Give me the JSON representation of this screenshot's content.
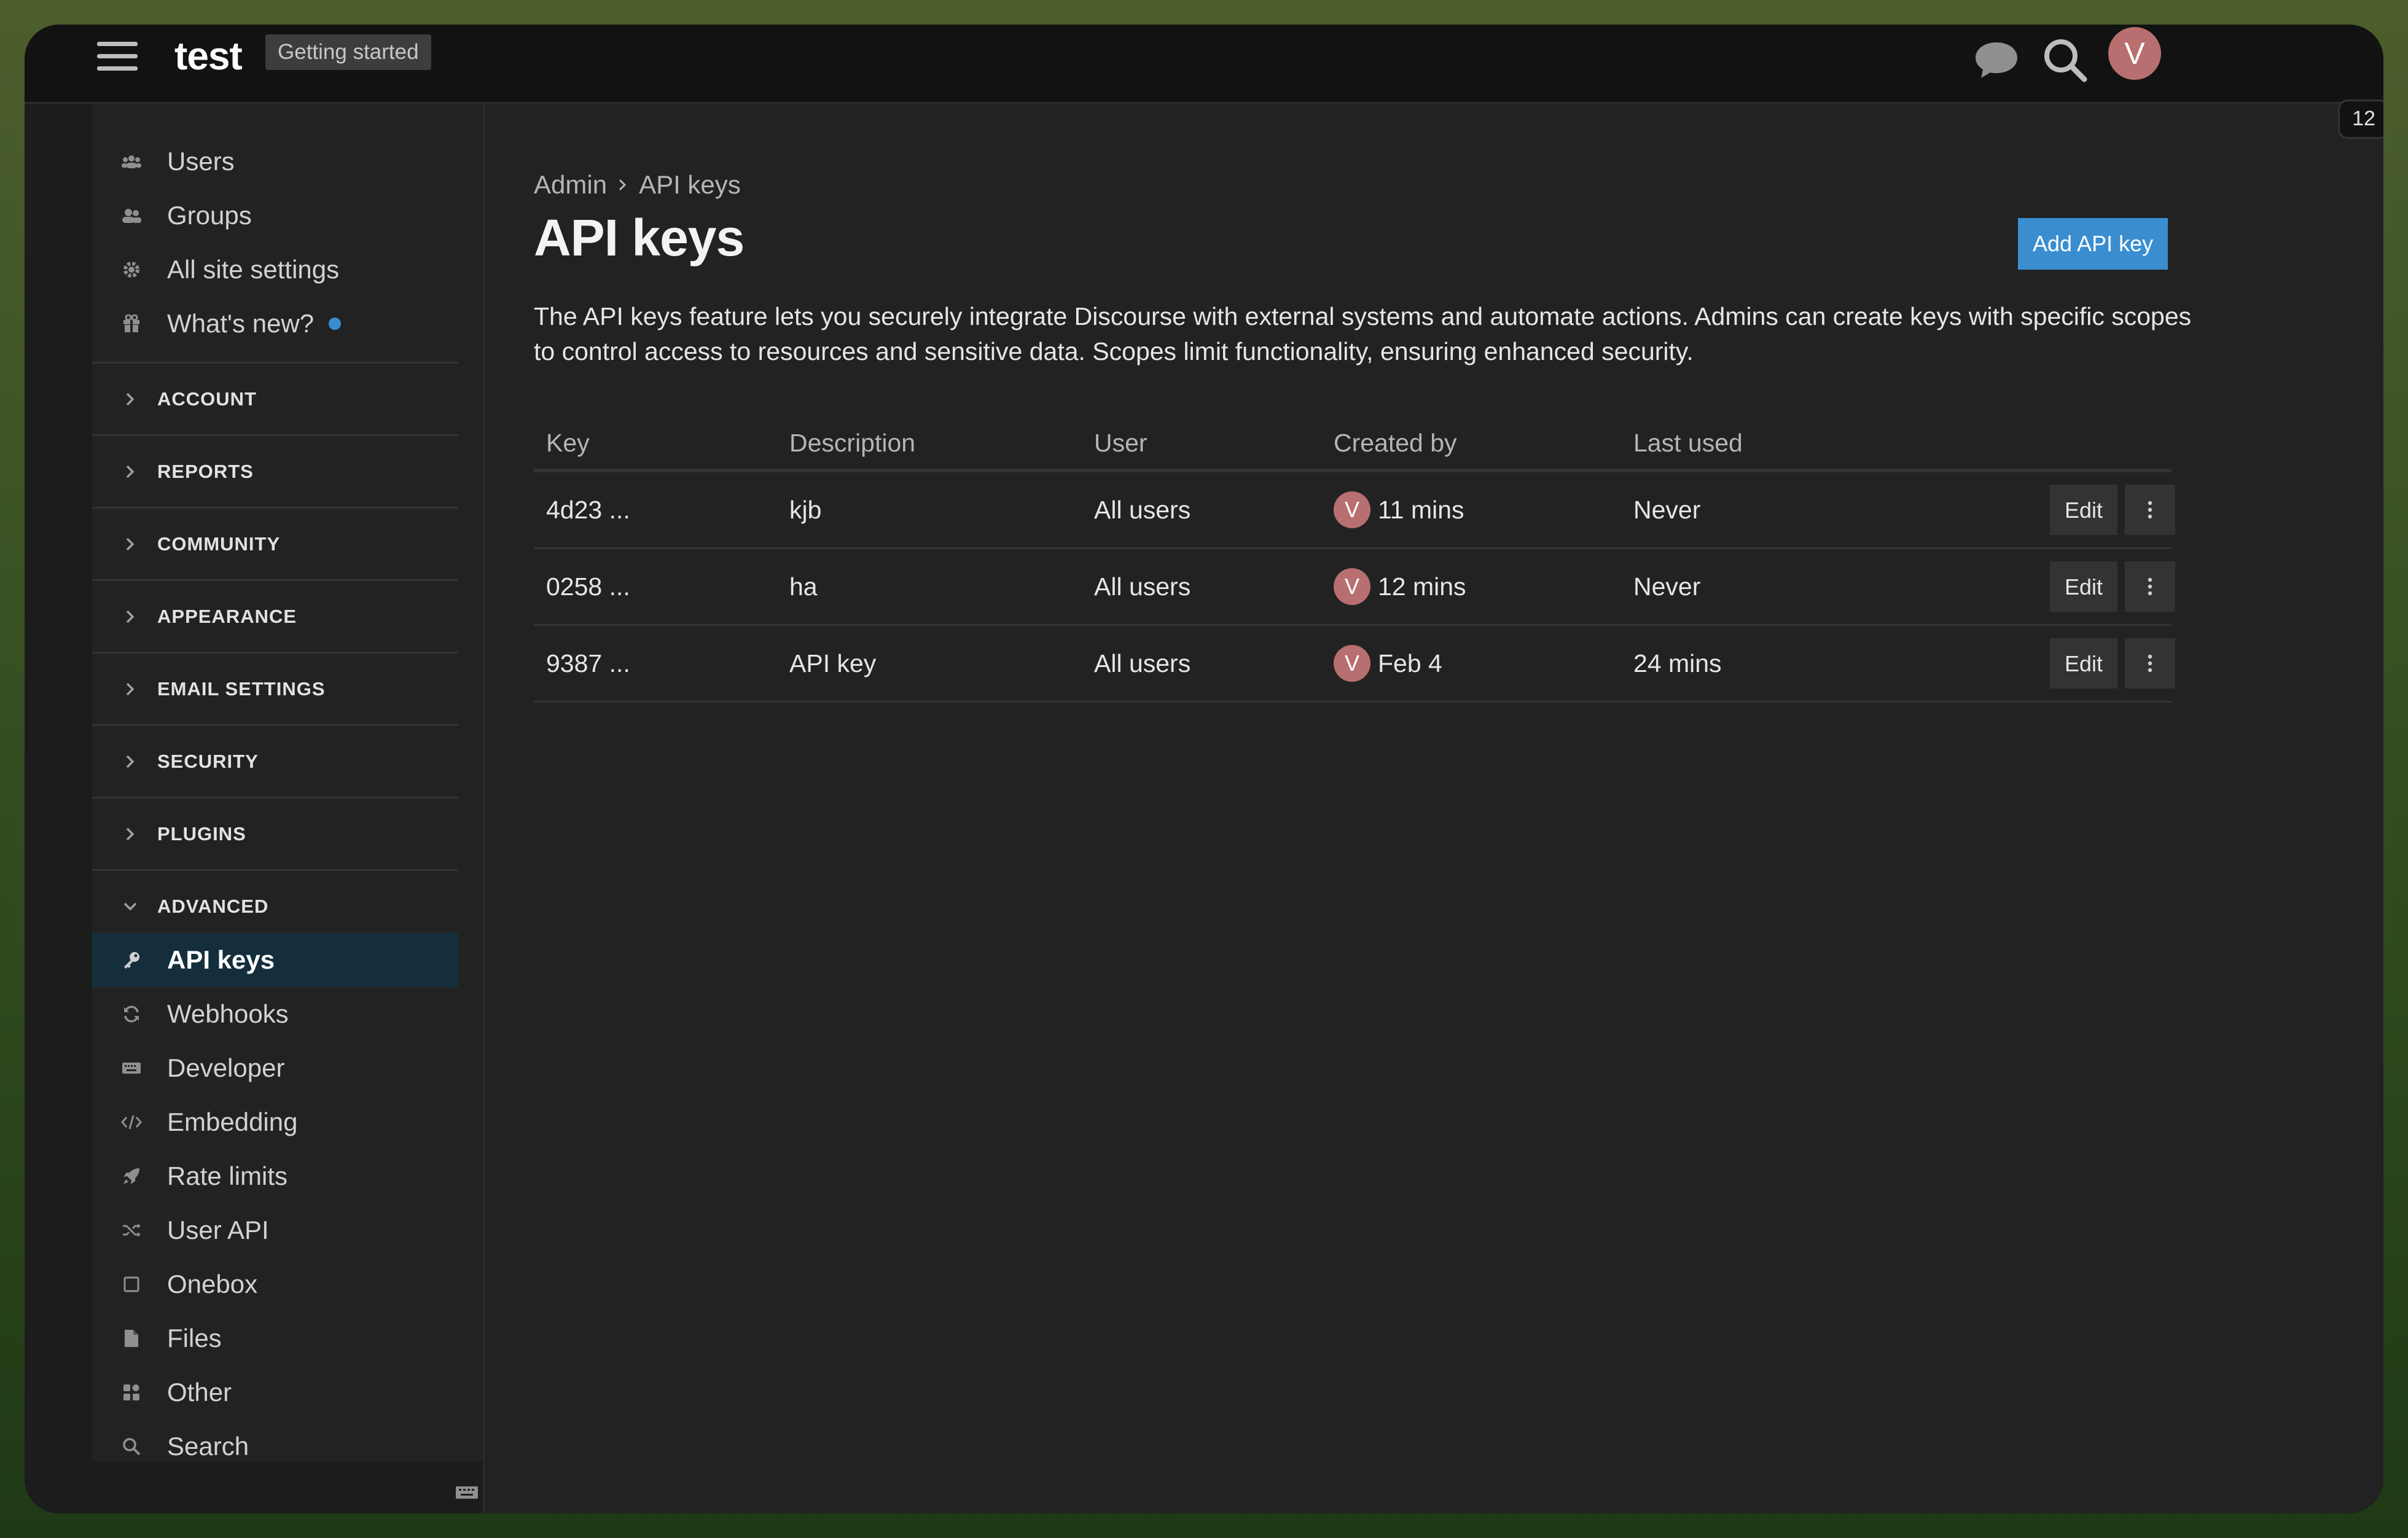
{
  "header": {
    "site_title": "test",
    "getting_started": "Getting started",
    "avatar_letter": "V",
    "notification_count": "12"
  },
  "sidebar": {
    "items_top": [
      {
        "label": "Users",
        "icon": "users-icon"
      },
      {
        "label": "Groups",
        "icon": "groups-icon"
      },
      {
        "label": "All site settings",
        "icon": "gear-icon"
      },
      {
        "label": "What's new?",
        "icon": "gift-icon"
      }
    ],
    "sections": [
      {
        "label": "ACCOUNT"
      },
      {
        "label": "REPORTS"
      },
      {
        "label": "COMMUNITY"
      },
      {
        "label": "APPEARANCE"
      },
      {
        "label": "EMAIL SETTINGS"
      },
      {
        "label": "SECURITY"
      },
      {
        "label": "PLUGINS"
      },
      {
        "label": "ADVANCED"
      }
    ],
    "advanced_items": [
      {
        "label": "API keys",
        "icon": "key-icon",
        "active": true
      },
      {
        "label": "Webhooks",
        "icon": "refresh-icon"
      },
      {
        "label": "Developer",
        "icon": "keyboard-icon"
      },
      {
        "label": "Embedding",
        "icon": "code-icon"
      },
      {
        "label": "Rate limits",
        "icon": "rocket-icon"
      },
      {
        "label": "User API",
        "icon": "shuffle-icon"
      },
      {
        "label": "Onebox",
        "icon": "square-icon"
      },
      {
        "label": "Files",
        "icon": "file-icon"
      },
      {
        "label": "Other",
        "icon": "grid-icon"
      },
      {
        "label": "Search",
        "icon": "search-icon"
      }
    ]
  },
  "main": {
    "breadcrumb": [
      "Admin",
      "API keys"
    ],
    "title": "API keys",
    "add_button": "Add API key",
    "description": "The API keys feature lets you securely integrate Discourse with external systems and automate actions. Admins can create keys with specific scopes to control access to resources and sensitive data. Scopes limit functionality, ensuring enhanced security.",
    "columns": [
      "Key",
      "Description",
      "User",
      "Created by",
      "Last used"
    ],
    "rows": [
      {
        "key": "4d23 ...",
        "description": "kjb",
        "user": "All users",
        "created_avatar": "V",
        "created": "11 mins",
        "last_used": "Never"
      },
      {
        "key": "0258 ...",
        "description": "ha",
        "user": "All users",
        "created_avatar": "V",
        "created": "12 mins",
        "last_used": "Never"
      },
      {
        "key": "9387 ...",
        "description": "API key",
        "user": "All users",
        "created_avatar": "V",
        "created": "Feb 4",
        "last_used": "24 mins"
      }
    ],
    "edit_label": "Edit"
  }
}
